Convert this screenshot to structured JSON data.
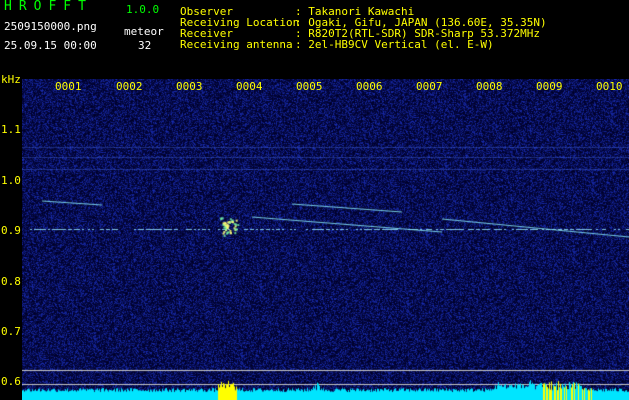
{
  "header": {
    "app_name": "HROFFT",
    "version": "1.0.0",
    "file_name": "2509150000.png",
    "datetime": "25.09.15 00:00",
    "meteor_label": "meteor",
    "meteor_count": "32"
  },
  "info": {
    "observer_label": "Observer",
    "observer_value": ": Takanori Kawachi",
    "location_label": "Receiving Location",
    "location_value": ": Ogaki, Gifu, JAPAN (136.60E, 35.35N)",
    "receiver_label": "Receiver",
    "receiver_value": ": R820T2(RTL-SDR) SDR-Sharp 53.372MHz",
    "antenna_label": "Receiving antenna",
    "antenna_value": ": 2el-HB9CV Vertical (el. E-W)"
  },
  "axis": {
    "unit": "kHz",
    "minutes": [
      "0001",
      "0002",
      "0003",
      "0004",
      "0005",
      "0006",
      "0007",
      "0008",
      "0009",
      "0010"
    ],
    "freq_labels": [
      "1.1",
      "1.0",
      "0.9",
      "0.8",
      "0.7",
      "0.6"
    ]
  },
  "colors": {
    "background": "#000000",
    "noise": "#1a2aa0",
    "signal": "#7ffcff",
    "burst": "#ffff00",
    "label": "#ffff00",
    "title": "#00ff00"
  }
}
